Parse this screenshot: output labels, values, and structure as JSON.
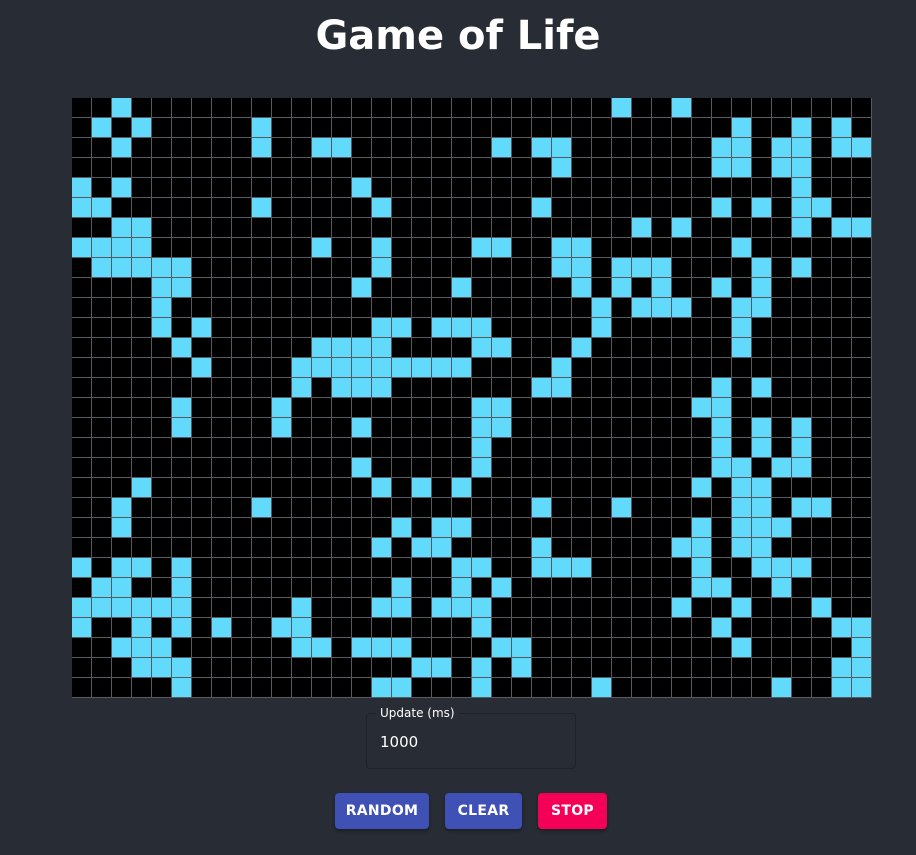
{
  "title": "Game of Life",
  "colors": {
    "background": "#282c34",
    "alive": "#61dafb",
    "dead": "#000000",
    "gridline": "#555a60",
    "primary_button": "#3f51b5",
    "secondary_button": "#f50057"
  },
  "board": {
    "rows": 30,
    "cols": 40,
    "cells": [
      "..x........................x..x.........",
      ".x.x.....x.......................x..x.x.",
      "..x......x..xx.......x.xx.......xx.xx.xx",
      "........................x.......xx.xx...",
      "x.x...........x.....................x...",
      "xx.......x.....x.......x........x.x.xx..",
      "..xx........................x.x.....x.xx",
      "xxxx........x..x....xx..xx.......x......",
      ".xxxxx.........x........xx.xxx....x.x...",
      "....xx........x....x.....x.x.x..x.x.....",
      "....x.....................x.xxx..xx.....",
      "....x.x........xx.xxx.....x......x......",
      ".....x......xxxx....xx...x.......x......",
      "......x....xxxxxxxxx....x...............",
      "...........x.xxx.......xx.......x.x.....",
      ".....x....x.........xx.........xx.......",
      ".....x....x...x.....xx..........x.x.x...",
      "....................x...........x.x.x...",
      "..............x.....x...........xx.xx...",
      "...x...........x.x.x...........x.xx.....",
      "..x......x.............x...x.....xx.xx..",
      "..x.............x.xx...........x.xxx....",
      "...............x.xx....x......xx.xx.....",
      "x.xx.x.............xx..xxx.....x..xxx...",
      ".xx..x..........x..x.x.........xx..x....",
      "xxxxxx.....x...xx.xxx.........x..x...x..",
      "x..x.x.x..xx........x...........x.....xx",
      "..xxx......xx.xxx....xx..........x.....x",
      "...xxx...........xx.x.x...............xx",
      ".....x.........xx...x.....x........x..xx"
    ]
  },
  "update_field": {
    "label": "Update (ms)",
    "value": "1000"
  },
  "buttons": {
    "random": "RANDOM",
    "clear": "CLEAR",
    "stop": "STOP"
  }
}
